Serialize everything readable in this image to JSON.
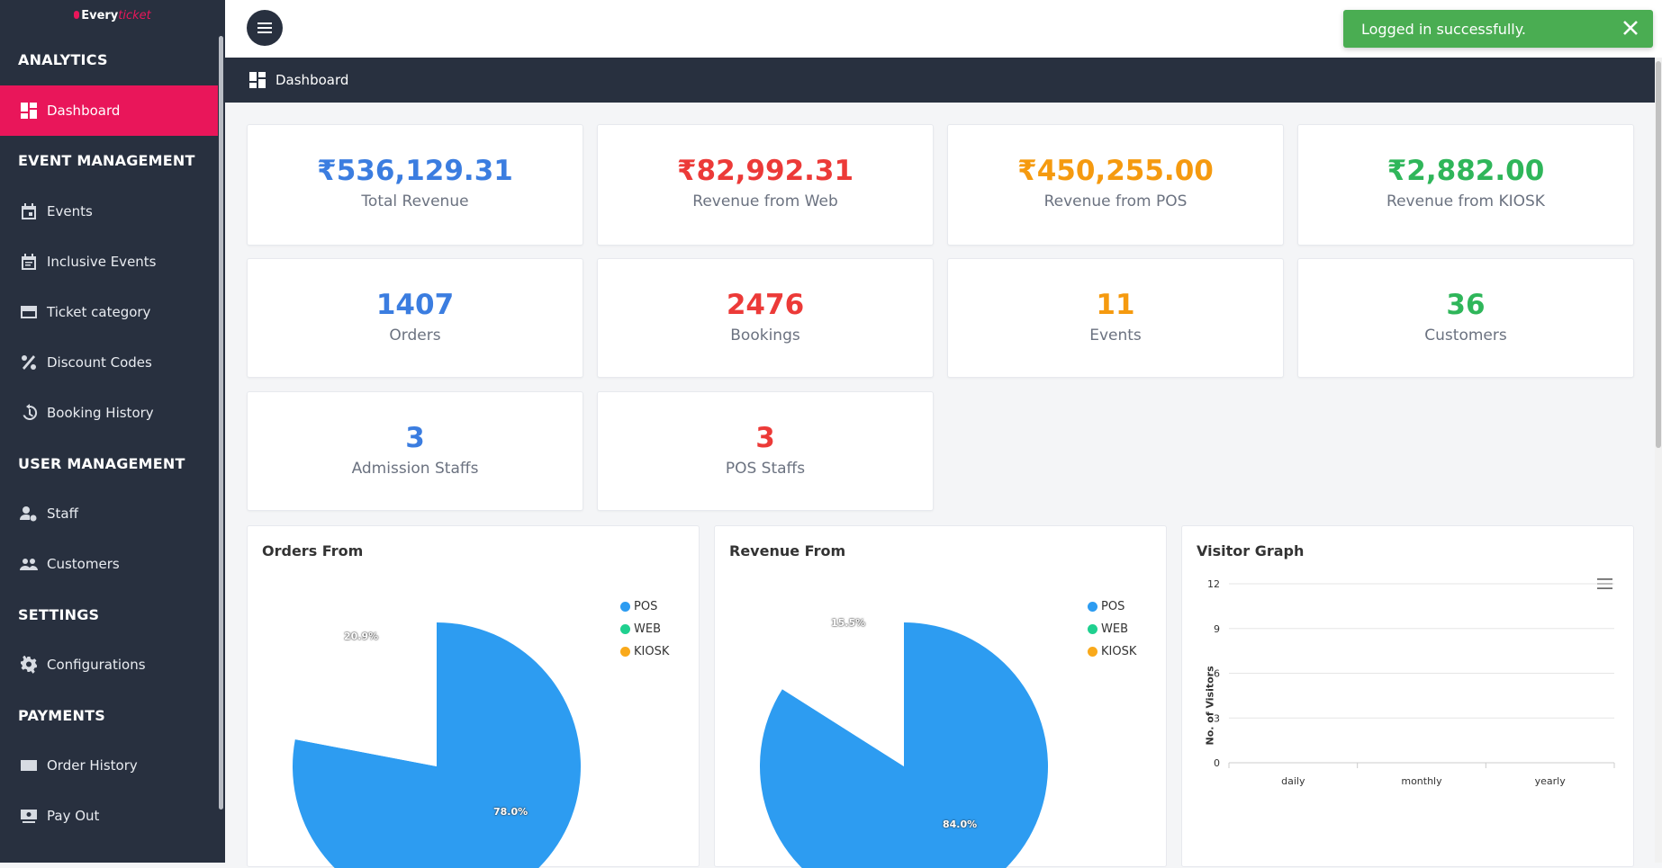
{
  "app": {
    "logo_left": "Every",
    "logo_right": "ticket"
  },
  "sidebar": {
    "sections": {
      "analytics": "ANALYTICS",
      "event_management": "EVENT MANAGEMENT",
      "user_management": "USER MANAGEMENT",
      "settings": "SETTINGS",
      "payments": "PAYMENTS"
    },
    "items": {
      "dashboard": "Dashboard",
      "events": "Events",
      "inclusive_events": "Inclusive Events",
      "ticket_category": "Ticket category",
      "discount_codes": "Discount Codes",
      "booking_history": "Booking History",
      "staff": "Staff",
      "customers": "Customers",
      "configurations": "Configurations",
      "order_history": "Order History",
      "pay_out": "Pay Out"
    },
    "active": "Dashboard"
  },
  "toast": {
    "message": "Logged in successfully."
  },
  "page": {
    "title": "Dashboard"
  },
  "stats": {
    "total_revenue": {
      "value": "₹536,129.31",
      "label": "Total Revenue"
    },
    "web_revenue": {
      "value": "₹82,992.31",
      "label": "Revenue from Web"
    },
    "pos_revenue": {
      "value": "₹450,255.00",
      "label": "Revenue from POS"
    },
    "kiosk_revenue": {
      "value": "₹2,882.00",
      "label": "Revenue from KIOSK"
    },
    "orders": {
      "value": "1407",
      "label": "Orders"
    },
    "bookings": {
      "value": "2476",
      "label": "Bookings"
    },
    "events": {
      "value": "11",
      "label": "Events"
    },
    "customers": {
      "value": "36",
      "label": "Customers"
    },
    "admission_staffs": {
      "value": "3",
      "label": "Admission Staffs"
    },
    "pos_staffs": {
      "value": "3",
      "label": "POS Staffs"
    }
  },
  "colors": {
    "accent": "#e9165a",
    "sidebar": "#28303f",
    "pos": "#2d9cf1",
    "web": "#1fd08f",
    "kiosk": "#f9a91b",
    "toast": "#4aad52"
  },
  "chart_data": [
    {
      "type": "pie",
      "title": "Orders From",
      "categories": [
        "POS",
        "WEB",
        "KIOSK"
      ],
      "values": [
        78.0,
        20.9,
        1.1
      ],
      "data_labels": {
        "pos": "78.0%",
        "web": "20.9%"
      },
      "legend": "top-right"
    },
    {
      "type": "pie",
      "title": "Revenue From",
      "categories": [
        "POS",
        "WEB",
        "KIOSK"
      ],
      "values": [
        84.0,
        15.5,
        0.5
      ],
      "data_labels": {
        "pos": "84.0%",
        "web": "15.5%"
      },
      "legend": "top-right"
    },
    {
      "type": "bar",
      "title": "Visitor Graph",
      "categories": [
        "daily",
        "monthly",
        "yearly"
      ],
      "values": [
        0,
        0,
        0
      ],
      "ylabel": "No. of Visitors",
      "yticks": [
        "0",
        "3",
        "6",
        "9",
        "12"
      ],
      "ylim": [
        0,
        12
      ],
      "grid": true
    }
  ]
}
